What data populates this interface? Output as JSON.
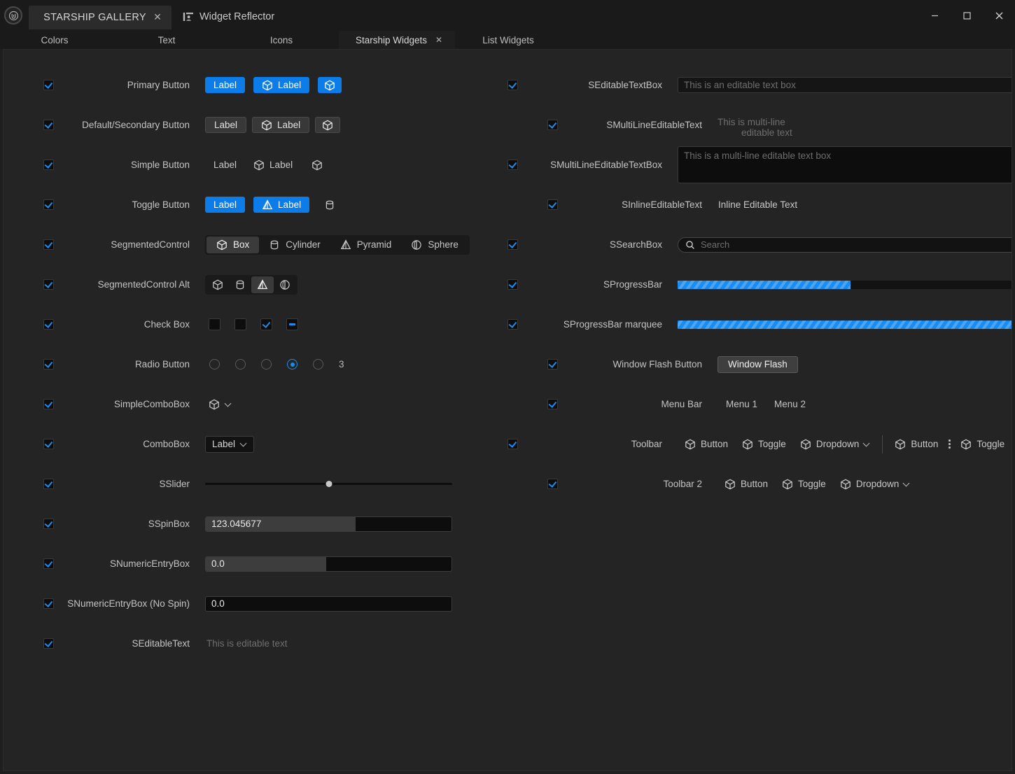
{
  "titlebar": {
    "logo_icon": "unreal-engine-logo",
    "major_tab": {
      "label": "STARSHIP GALLERY",
      "close_icon": "close-icon"
    },
    "reflector": {
      "icon": "widget-reflector-icon",
      "label": "Widget Reflector"
    },
    "window_controls": {
      "minimize": "—",
      "maximize": "☐",
      "close": "✕"
    }
  },
  "tabs": [
    {
      "label": "Colors",
      "active": false
    },
    {
      "label": "Text",
      "active": false
    },
    {
      "label": "Icons",
      "active": false
    },
    {
      "label": "Starship Widgets",
      "active": true,
      "close_icon": "close-icon"
    },
    {
      "label": "List Widgets",
      "active": false
    }
  ],
  "colors": {
    "accent_blue": "#0c7ce8",
    "check_blue": "#1a8cf0",
    "window_bg": "#1f1f1f",
    "content_bg": "#242424",
    "titlebar_bg": "#1a1a1a",
    "label_text": "#c4c4c4",
    "placeholder_text": "#6e6e6e"
  },
  "left_column": [
    {
      "enabled": true,
      "label": "Primary Button",
      "kind": "buttons",
      "buttons": [
        {
          "style": "primary",
          "text": "Label",
          "icon": null
        },
        {
          "style": "primary",
          "text": "Label",
          "icon": "box-icon"
        },
        {
          "style": "primary",
          "text": "",
          "icon": "box-icon"
        }
      ]
    },
    {
      "enabled": true,
      "label": "Default/Secondary Button",
      "kind": "buttons",
      "buttons": [
        {
          "style": "secondary",
          "text": "Label",
          "icon": null
        },
        {
          "style": "secondary",
          "text": "Label",
          "icon": "box-icon"
        },
        {
          "style": "secondary",
          "text": "",
          "icon": "box-icon"
        }
      ]
    },
    {
      "enabled": true,
      "label": "Simple Button",
      "kind": "buttons",
      "buttons": [
        {
          "style": "simple",
          "text": "Label",
          "icon": null
        },
        {
          "style": "simple",
          "text": "Label",
          "icon": "box-icon"
        },
        {
          "style": "simple",
          "text": "",
          "icon": "box-icon"
        }
      ]
    },
    {
      "enabled": true,
      "label": "Toggle Button",
      "kind": "buttons",
      "buttons": [
        {
          "style": "primary",
          "text": "Label",
          "icon": null
        },
        {
          "style": "primary",
          "text": "Label",
          "icon": "pyramid-icon"
        },
        {
          "style": "simple",
          "text": "",
          "icon": "cylinder-icon"
        }
      ]
    },
    {
      "enabled": true,
      "label": "SegmentedControl",
      "kind": "segmented",
      "items": [
        {
          "label": "Box",
          "icon": "box-icon",
          "selected": true
        },
        {
          "label": "Cylinder",
          "icon": "cylinder-icon",
          "selected": false
        },
        {
          "label": "Pyramid",
          "icon": "pyramid-icon",
          "selected": false
        },
        {
          "label": "Sphere",
          "icon": "sphere-icon",
          "selected": false
        }
      ]
    },
    {
      "enabled": true,
      "label": "SegmentedControl Alt",
      "kind": "segmented_alt",
      "items": [
        {
          "label": "",
          "icon": "box-icon",
          "selected": false
        },
        {
          "label": "",
          "icon": "cylinder-icon",
          "selected": false
        },
        {
          "label": "",
          "icon": "pyramid-icon",
          "selected": true
        },
        {
          "label": "",
          "icon": "sphere-icon",
          "selected": false
        }
      ]
    },
    {
      "enabled": true,
      "label": "Check Box",
      "kind": "checkboxes",
      "boxes": [
        {
          "state": "unchecked"
        },
        {
          "state": "unchecked"
        },
        {
          "state": "checked"
        },
        {
          "state": "indeterminate"
        }
      ]
    },
    {
      "enabled": true,
      "label": "Radio Button",
      "kind": "radios",
      "count": 5,
      "selected_index": 3,
      "value_label": "3"
    },
    {
      "enabled": true,
      "label": "SimpleComboBox",
      "kind": "simple_combo",
      "icon": "box-icon",
      "chevron": "chevron-down-icon"
    },
    {
      "enabled": true,
      "label": "ComboBox",
      "kind": "combo",
      "text": "Label",
      "chevron": "chevron-down-icon"
    },
    {
      "enabled": true,
      "label": "SSlider",
      "kind": "slider",
      "value_percent": 50
    },
    {
      "enabled": true,
      "label": "SSpinBox",
      "kind": "spinbox",
      "value": "123.045677",
      "fill_percent": 61
    },
    {
      "enabled": true,
      "label": "SNumericEntryBox",
      "kind": "spinbox",
      "value": "0.0",
      "fill_percent": 49
    },
    {
      "enabled": true,
      "label": "SNumericEntryBox (No Spin)",
      "kind": "spinbox",
      "value": "0.0",
      "fill_percent": 0
    },
    {
      "enabled": true,
      "label": "SEditableText",
      "kind": "inline_text",
      "text": "This is editable text"
    }
  ],
  "right_column": [
    {
      "enabled": true,
      "label": "SEditableTextBox",
      "kind": "textbox",
      "placeholder": "This is an editable text box"
    },
    {
      "enabled": true,
      "label": "SMultiLineEditableText",
      "kind": "multiline_text",
      "line1": "This is multi-line",
      "line2": "editable text"
    },
    {
      "enabled": true,
      "label": "SMultiLineEditableTextBox",
      "kind": "multiline_textbox",
      "placeholder": "This is a multi-line editable text box"
    },
    {
      "enabled": true,
      "label": "SInlineEditableText",
      "kind": "inline_text_bright",
      "text": "Inline Editable Text"
    },
    {
      "enabled": true,
      "label": "SSearchBox",
      "kind": "searchbox",
      "icon": "search-icon",
      "placeholder": "Search"
    },
    {
      "enabled": true,
      "label": "SProgressBar",
      "kind": "progress",
      "value_percent": 50
    },
    {
      "enabled": true,
      "label": "SProgressBar marquee",
      "kind": "progress",
      "value_percent": 100
    },
    {
      "enabled": true,
      "label": "Window Flash Button",
      "kind": "flash_button",
      "text": "Window Flash"
    },
    {
      "enabled": true,
      "label": "Menu Bar",
      "kind": "menubar",
      "items": [
        "Menu 1",
        "Menu 2"
      ]
    },
    {
      "enabled": true,
      "label": "Toolbar",
      "kind": "toolbar",
      "items": [
        {
          "type": "button",
          "label": "Button",
          "icon": "box-icon"
        },
        {
          "type": "toggle",
          "label": "Toggle",
          "icon": "box-icon"
        },
        {
          "type": "dropdown",
          "label": "Dropdown",
          "icon": "box-icon",
          "chevron": "chevron-down-icon"
        },
        {
          "type": "separator"
        },
        {
          "type": "button",
          "label": "Button",
          "icon": "box-icon"
        },
        {
          "type": "overflow",
          "icon": "vertical-dots-icon"
        },
        {
          "type": "toggle",
          "label": "Toggle",
          "icon": "box-icon"
        },
        {
          "type": "overflow",
          "icon": "vertical-dots-icon"
        }
      ]
    },
    {
      "enabled": true,
      "label": "Toolbar 2",
      "kind": "toolbar",
      "items": [
        {
          "type": "button",
          "label": "Button",
          "icon": "box-icon"
        },
        {
          "type": "toggle",
          "label": "Toggle",
          "icon": "box-icon"
        },
        {
          "type": "dropdown",
          "label": "Dropdown",
          "icon": "box-icon",
          "chevron": "chevron-down-icon"
        }
      ]
    }
  ]
}
